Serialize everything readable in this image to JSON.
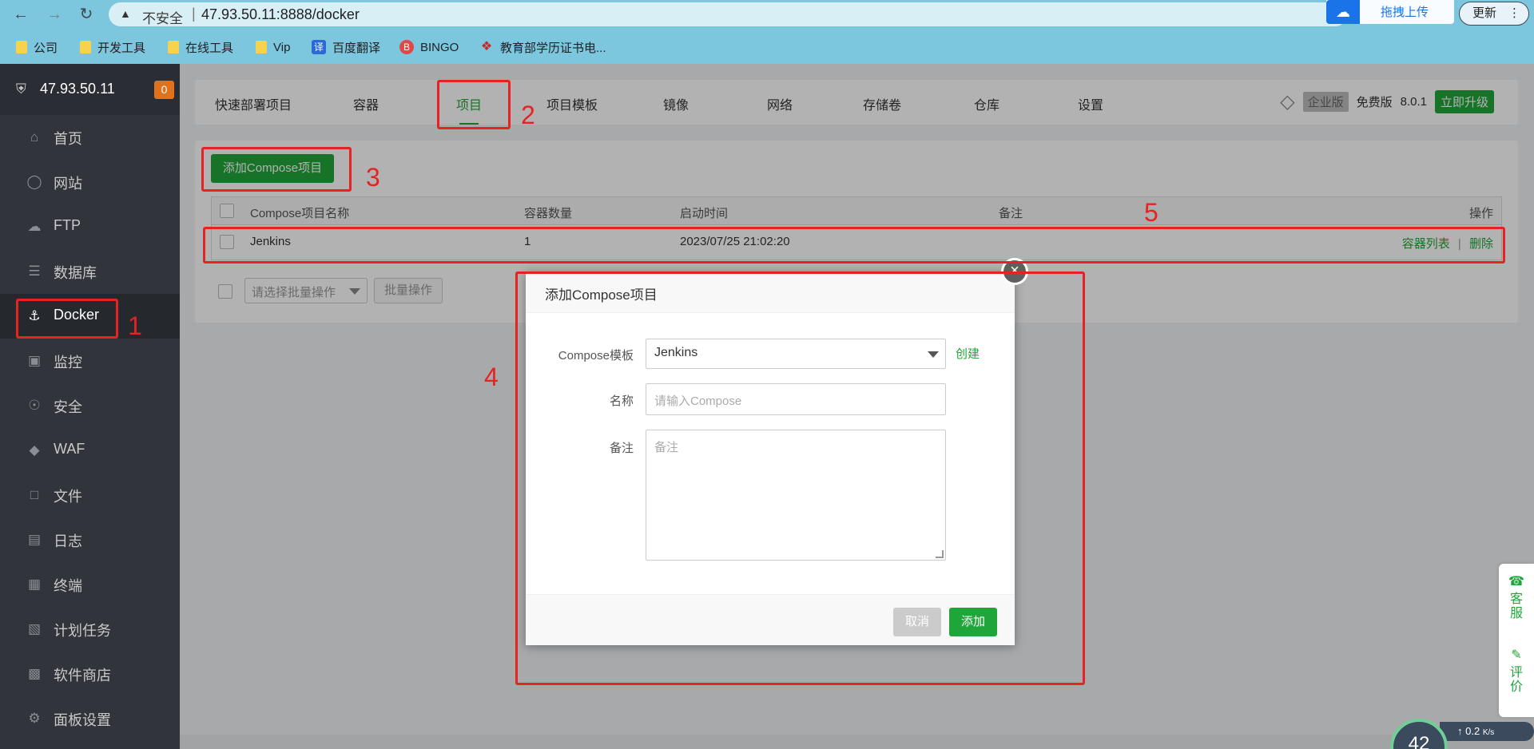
{
  "browser": {
    "insecure_label": "不安全",
    "separator": "|",
    "url": "47.93.50.11:8888/docker",
    "extension_label": "拖拽上传",
    "update_label": "更新",
    "bookmarks": [
      {
        "label": "公司"
      },
      {
        "label": "开发工具"
      },
      {
        "label": "在线工具"
      },
      {
        "label": "Vip"
      },
      {
        "label": "百度翻译"
      },
      {
        "label": "BINGO"
      },
      {
        "label": "教育部学历证书电..."
      }
    ]
  },
  "sidebar": {
    "server_ip": "47.93.50.11",
    "badge_count": "0",
    "items": [
      {
        "label": "首页",
        "icon": "home-icon"
      },
      {
        "label": "网站",
        "icon": "globe-icon"
      },
      {
        "label": "FTP",
        "icon": "ftp-icon"
      },
      {
        "label": "数据库",
        "icon": "database-icon"
      },
      {
        "label": "Docker",
        "icon": "docker-icon"
      },
      {
        "label": "监控",
        "icon": "monitor-icon"
      },
      {
        "label": "安全",
        "icon": "shield-icon"
      },
      {
        "label": "WAF",
        "icon": "waf-icon"
      },
      {
        "label": "文件",
        "icon": "folder-icon"
      },
      {
        "label": "日志",
        "icon": "log-icon"
      },
      {
        "label": "终端",
        "icon": "terminal-icon"
      },
      {
        "label": "计划任务",
        "icon": "calendar-icon"
      },
      {
        "label": "软件商店",
        "icon": "apps-icon"
      },
      {
        "label": "面板设置",
        "icon": "settings-icon"
      }
    ],
    "active": "Docker"
  },
  "tabs": [
    {
      "label": "快速部署项目"
    },
    {
      "label": "容器"
    },
    {
      "label": "项目"
    },
    {
      "label": "项目模板"
    },
    {
      "label": "镜像"
    },
    {
      "label": "网络"
    },
    {
      "label": "存储卷"
    },
    {
      "label": "仓库"
    },
    {
      "label": "设置"
    }
  ],
  "edition": {
    "enterprise": "企业版",
    "free": "免费版",
    "version": "8.0.1",
    "upgrade": "立即升级"
  },
  "project": {
    "add_button": "添加Compose项目",
    "columns": [
      "Compose项目名称",
      "容器数量",
      "启动时间",
      "备注",
      "操作"
    ],
    "rows": [
      {
        "name": "Jenkins",
        "count": "1",
        "start_time": "2023/07/25 21:02:20",
        "note": "",
        "ops": [
          "容器列表",
          "删除"
        ],
        "op_sep": "|"
      }
    ],
    "bulk_placeholder": "请选择批量操作",
    "bulk_button": "批量操作"
  },
  "dialog": {
    "title": "添加Compose项目",
    "template_label": "Compose模板",
    "template_value": "Jenkins",
    "create_link": "创建",
    "name_label": "名称",
    "name_placeholder": "请输入Compose",
    "note_label": "备注",
    "note_placeholder": "备注",
    "cancel": "取消",
    "add": "添加"
  },
  "annotations": [
    "1",
    "2",
    "3",
    "4",
    "5"
  ],
  "float_widget": {
    "service": "客服",
    "review": "评价"
  },
  "speed": {
    "percent": "42",
    "rate": "0.2",
    "unit": "K/s"
  },
  "colors": {
    "accent": "#20a53a",
    "sidebar_bg": "#31343a",
    "annotation": "#e52323",
    "browser_bar": "#7cc6de"
  }
}
